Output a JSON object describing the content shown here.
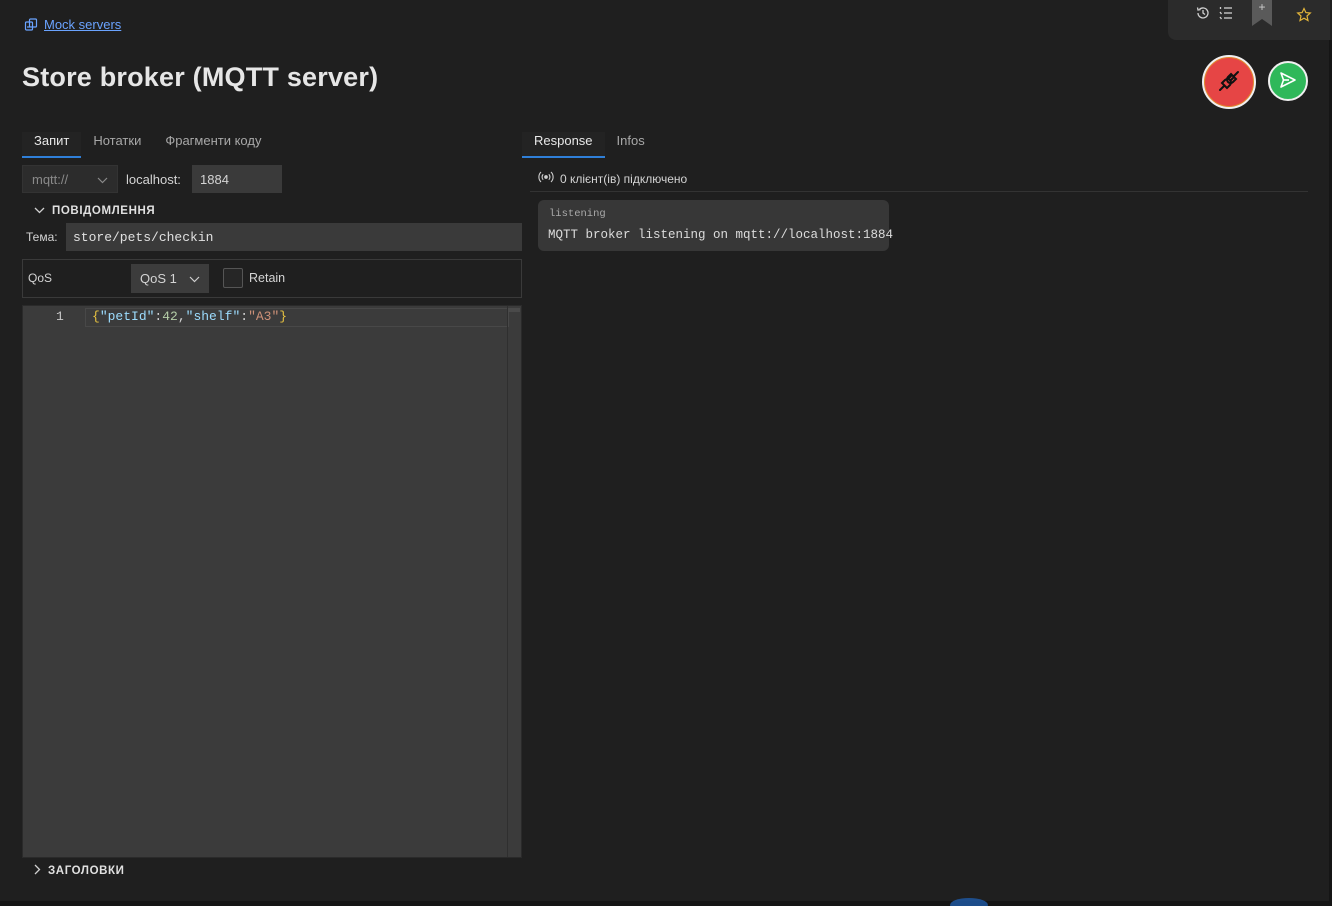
{
  "breadcrumb": {
    "label": "Mock servers",
    "icon": "mock-server-icon"
  },
  "page": {
    "title": "Store broker (MQTT server)"
  },
  "toolbar": {
    "icons": [
      "history-icon",
      "list-icon",
      "bookmark-add-icon",
      "star-icon"
    ],
    "bookmark_plus": "+"
  },
  "actions": {
    "disconnect_icon": "plug-disconnect-icon",
    "send_icon": "send-icon",
    "colors": {
      "disconnect": "#e64545",
      "send": "#2fb85a"
    }
  },
  "request_tabs": [
    {
      "label": "Запит",
      "active": true
    },
    {
      "label": "Нотатки",
      "active": false
    },
    {
      "label": "Фрагменти коду",
      "active": false
    }
  ],
  "response_tabs": [
    {
      "label": "Response",
      "active": true
    },
    {
      "label": "Infos",
      "active": false
    }
  ],
  "url": {
    "scheme": "mqtt://",
    "host_label": "localhost:",
    "port": "1884"
  },
  "message_section": {
    "title": "ПОВІДОМЛЕННЯ",
    "expanded": true
  },
  "topic": {
    "label": "Тема:",
    "value": "store/pets/checkin"
  },
  "qos": {
    "label": "QoS",
    "selected": "QoS 1",
    "retain_label": "Retain",
    "retain_checked": false
  },
  "editor": {
    "line_number": "1",
    "tokens": {
      "open": "{",
      "key1": "\"petId\"",
      "colon1": ":",
      "val1": "42",
      "comma": ",",
      "key2": "\"shelf\"",
      "colon2": ":",
      "val2": "\"A3\"",
      "close": "}"
    }
  },
  "headers_section": {
    "title": "ЗАГОЛОВКИ",
    "expanded": false
  },
  "status": {
    "icon": "broadcast-icon",
    "text": "0 клієнт(ів) підключено"
  },
  "log": [
    {
      "type": "listening",
      "message": "MQTT broker listening on mqtt://localhost:1884"
    }
  ],
  "theme": {
    "accent": "#2f7fd8",
    "link": "#6aa3ff",
    "background": "#1f1f1f"
  }
}
